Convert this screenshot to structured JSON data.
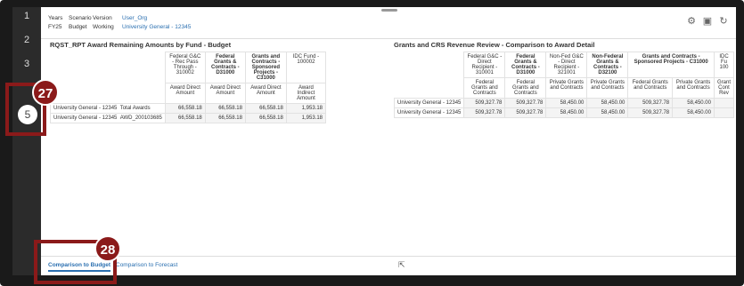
{
  "sidebar": {
    "steps": [
      "1",
      "2",
      "3",
      "5"
    ]
  },
  "pov": {
    "labels": [
      "Years",
      "Scenario",
      "Version",
      "User_Org"
    ],
    "values": [
      "FY25",
      "Budget",
      "Working",
      "University General - 12345"
    ]
  },
  "left_title": "RQST_RPT Award Remaining Amounts by Fund - Budget",
  "right_title": "Grants and CRS Revenue Review - Comparison to Award Detail",
  "left": {
    "headers": [
      "Federal G&C - Rec Pass Through - 310002",
      "Federal Grants & Contracts - D31000",
      "Grants and Contracts - Sponsored Projects - C31000",
      "IDC Fund - 100002"
    ],
    "sub": [
      "Award Direct Amount",
      "Award Direct Amount",
      "Award Direct Amount",
      "Award Indirect Amount"
    ],
    "rows": [
      {
        "org": "University General - 12345",
        "label": "Total Awards",
        "vals": [
          "66,558.18",
          "66,558.18",
          "66,558.18",
          "1,953.18"
        ]
      },
      {
        "org": "University General - 12345",
        "label": "AWD_200103685",
        "vals": [
          "66,558.18",
          "66,558.18",
          "66,558.18",
          "1,953.18"
        ]
      }
    ]
  },
  "right": {
    "headers": [
      "Federal G&C - Direct Recipient - 310001",
      "Federal Grants & Contracts - D31000",
      "Non-Fed G&C - Direct Recipient - 321001",
      "Non-Federal Grants & Contracts - D32100",
      "Grants and Contracts - Sponsored Projects - C31000",
      "",
      "IDC Fu 100"
    ],
    "sub": [
      "Federal Grants and Contracts",
      "Federal Grants and Contracts",
      "Private Grants and Contracts",
      "Private Grants and Contracts",
      "Federal Grants and Contracts",
      "Private Grants and Contracts",
      "Grant Cont Rev"
    ],
    "rows": [
      {
        "org": "University General - 12345",
        "vals": [
          "509,327.78",
          "509,327.78",
          "58,450.00",
          "58,450.00",
          "509,327.78",
          "58,450.00",
          ""
        ]
      },
      {
        "org": "University General - 12345",
        "vals": [
          "509,327.78",
          "509,327.78",
          "58,450.00",
          "58,450.00",
          "509,327.78",
          "58,450.00",
          ""
        ]
      }
    ]
  },
  "tabs": {
    "active": "Comparison to Budget",
    "other": "Comparison to Forecast"
  },
  "callouts": {
    "a": "27",
    "b": "28"
  }
}
